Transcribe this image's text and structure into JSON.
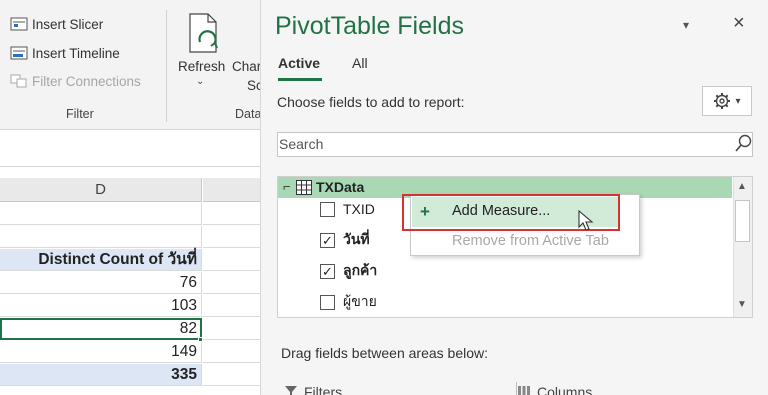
{
  "ribbon": {
    "items": [
      {
        "label": "Insert Slicer",
        "icon": "slicer-icon",
        "disabled": false
      },
      {
        "label": "Insert Timeline",
        "icon": "timeline-icon",
        "disabled": false
      },
      {
        "label": "Filter Connections",
        "icon": "filter-connections-icon",
        "disabled": true
      }
    ],
    "filter_group_label": "Filter",
    "refresh_label": "Refresh",
    "refresh_chevron": "⌄",
    "change_label": "Char",
    "change_sub": "Sc",
    "data_group_label": "Data"
  },
  "sheet": {
    "column_header": "D",
    "header_cell": "Distinct Count of วันที่",
    "values": [
      "76",
      "103",
      "82",
      "149"
    ],
    "total": "335"
  },
  "pane": {
    "title": "PivotTable Fields",
    "dropdown_glyph": "▾",
    "close_glyph": "×",
    "tabs": [
      {
        "label": "Active",
        "active": true
      },
      {
        "label": "All",
        "active": false
      }
    ],
    "choose_label": "Choose fields to add to report:",
    "search_placeholder": "Search",
    "table_expander": "⌐",
    "table_name": "TXData",
    "fields": [
      {
        "label": "TXID",
        "checked": false,
        "bold": false
      },
      {
        "label": "วันที่",
        "checked": true,
        "bold": true
      },
      {
        "label": "ลูกค้า",
        "checked": true,
        "bold": true
      },
      {
        "label": "ผู้ขาย",
        "checked": false,
        "bold": false
      }
    ],
    "check_glyph": "✓",
    "drag_label": "Drag fields between areas below:",
    "filters_label": "Filters",
    "columns_label": "Columns"
  },
  "context_menu": {
    "add_plus": "+",
    "add_measure": "Add Measure...",
    "remove": "Remove from Active Tab"
  },
  "colors": {
    "accent": "#217346",
    "highlight_row": "#a8d8b4",
    "menu_hover": "#d2ead8",
    "annotation_red": "#d93030"
  }
}
